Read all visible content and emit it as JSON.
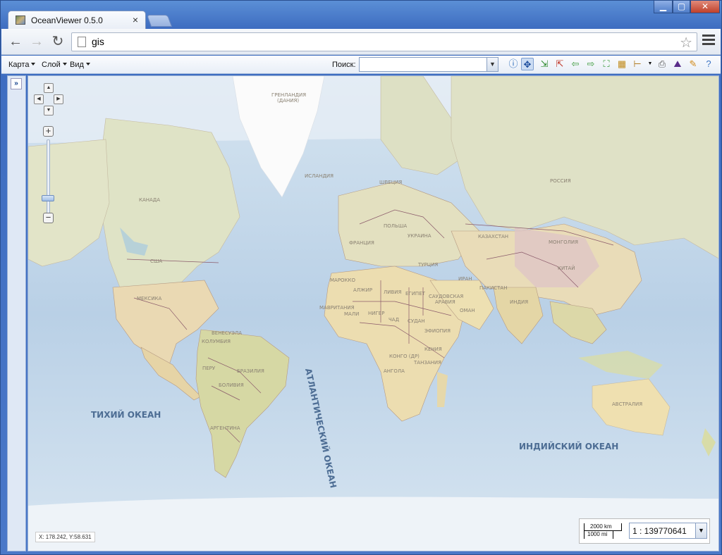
{
  "browser": {
    "tab_title": "OceanViewer 0.5.0",
    "tab_close": "×",
    "url": "gis",
    "window_controls": [
      "▁",
      "▢",
      "✕"
    ]
  },
  "app_toolbar": {
    "menus": [
      {
        "label": "Карта"
      },
      {
        "label": "Слой"
      },
      {
        "label": "Вид"
      }
    ],
    "search_label": "Поиск:",
    "search_value": "",
    "tools": [
      "info-icon",
      "pan-icon",
      "zoom-in-icon",
      "zoom-out-icon",
      "back-icon",
      "forward-icon",
      "full-extent-icon",
      "grid-icon",
      "measure-icon",
      "print-icon",
      "chart-icon",
      "edit-icon",
      "help-icon"
    ]
  },
  "map": {
    "labels": {
      "greenland": "ГРЕНЛАНДИЯ",
      "greenland_sub": "(ДАНИЯ)",
      "iceland": "ИСЛАНДИЯ",
      "canada": "КАНАДА",
      "usa": "США",
      "mexico": "МЕКСИКА",
      "sweden": "ШВЕЦИЯ",
      "poland": "ПОЛЬША",
      "ukraine": "УКРАИНА",
      "france": "ФРАНЦИЯ",
      "russia": "РОССИЯ",
      "kazakhstan": "КАЗАХСТАН",
      "mongolia": "МОНГОЛИЯ",
      "china": "КИТАЙ",
      "turkey": "ТУРЦИЯ",
      "iran": "ИРАН",
      "pakistan": "ПАКИСТАН",
      "india": "ИНДИЯ",
      "saudi": "САУДОВСКАЯ",
      "saudi2": "АРАВИЯ",
      "morocco": "МАРОККО",
      "algeria": "АЛЖИР",
      "libya": "ЛИВИЯ",
      "egypt": "ЕГИПЕТ",
      "mauritania": "МАВРИТАНИЯ",
      "mali": "МАЛИ",
      "niger": "НИГЕР",
      "chad": "ЧАД",
      "sudan": "СУДАН",
      "ethiopia": "ЭФИОПИЯ",
      "congo": "КОНГО (ДР)",
      "kenya": "КЕНИЯ",
      "tanzania": "ТАНЗАНИЯ",
      "angola": "АНГОЛА",
      "colombia": "КОЛУМБИЯ",
      "venezuela": "ВЕНЕСУЭЛА",
      "peru": "ПЕРУ",
      "brazil": "БРАЗИЛИЯ",
      "bolivia": "БОЛИВИЯ",
      "argentina": "АРГЕНТИНА",
      "australia": "АВСТРАЛИЯ",
      "oman": "ОМАН",
      "pacific": "ТИХИЙ ОКЕАН",
      "atlantic": "АТЛАНТИЧЕСКИЙ ОКЕАН",
      "indian": "ИНДИЙСКИЙ ОКЕАН"
    },
    "coords": "X: 178.242, Y:58.631",
    "scale_km": "2000 km",
    "scale_mi": "1000 mi",
    "scale_value": "1 : 139770641"
  }
}
